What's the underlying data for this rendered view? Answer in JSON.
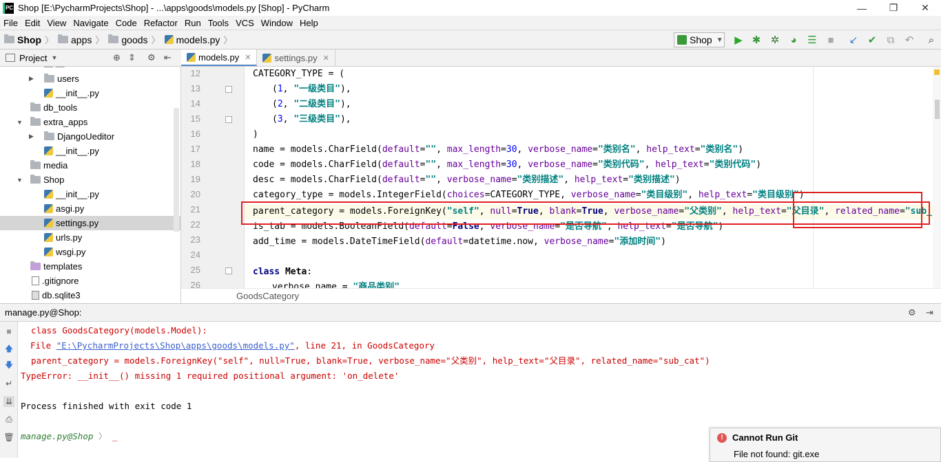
{
  "window": {
    "title": "Shop [E:\\PycharmProjects\\Shop] - ...\\apps\\goods\\models.py [Shop] - PyCharm",
    "icon_text": "PC"
  },
  "menu": [
    "File",
    "Edit",
    "View",
    "Navigate",
    "Code",
    "Refactor",
    "Run",
    "Tools",
    "VCS",
    "Window",
    "Help"
  ],
  "breadcrumb": [
    "Shop",
    "apps",
    "goods",
    "models.py"
  ],
  "run_config": "Shop",
  "project_panel": {
    "title": "Project"
  },
  "tree": [
    {
      "label": "users",
      "type": "folder",
      "expand": "collapsed"
    },
    {
      "label": "__init__.py",
      "type": "py"
    },
    {
      "label": "db_tools",
      "type": "folder"
    },
    {
      "label": "extra_apps",
      "type": "folder",
      "expand": "expanded"
    },
    {
      "label": "DjangoUeditor",
      "type": "folder",
      "expand": "collapsed"
    },
    {
      "label": "__init__.py",
      "type": "py"
    },
    {
      "label": "media",
      "type": "folder"
    },
    {
      "label": "Shop",
      "type": "folder",
      "expand": "expanded"
    },
    {
      "label": "__init__.py",
      "type": "py"
    },
    {
      "label": "asgi.py",
      "type": "py"
    },
    {
      "label": "settings.py",
      "type": "py",
      "selected": true
    },
    {
      "label": "urls.py",
      "type": "py"
    },
    {
      "label": "wsgi.py",
      "type": "py"
    },
    {
      "label": "templates",
      "type": "folder"
    },
    {
      "label": ".gitignore",
      "type": "file"
    },
    {
      "label": "db.sqlite3",
      "type": "file"
    }
  ],
  "tabs": [
    {
      "label": "models.py",
      "active": true
    },
    {
      "label": "settings.py",
      "active": false
    }
  ],
  "line_numbers": [
    "12",
    "13",
    "14",
    "15",
    "16",
    "17",
    "18",
    "19",
    "20",
    "21",
    "22",
    "23",
    "24",
    "25",
    "26"
  ],
  "code": {
    "l12": "CATEGORY_TYPE = (",
    "l13_num": "1",
    "l13_str": "\"一级类目\"",
    "l14_num": "2",
    "l14_str": "\"二级类目\"",
    "l15_num": "3",
    "l15_str": "\"三级类目\"",
    "l16": ")",
    "l17": {
      "a": "name = models.CharField(",
      "s1": "\"\"",
      "n": "30",
      "s2": "\"类别名\"",
      "s3": "\"类别名\""
    },
    "l18": {
      "a": "code = models.CharField(",
      "s1": "\"\"",
      "n": "30",
      "s2": "\"类别代码\"",
      "s3": "\"类别代码\""
    },
    "l19": {
      "a": "desc = models.CharField(",
      "s1": "\"\"",
      "s2": "\"类别描述\"",
      "s3": "\"类别描述\""
    },
    "l20": {
      "a": "category_type = models.IntegerField(",
      "b": "CATEGORY_TYPE",
      "s2": "\"类目级别\"",
      "s3": "\"类目级别\""
    },
    "l21": {
      "a": "parent_category = models.ForeignKey(",
      "s0": "\"self\"",
      "s2": "\"父类别\"",
      "s3": "\"父目录\"",
      "s4": "\"sub_cat\""
    },
    "l22": {
      "a": "is_tab = models.BooleanField(",
      "s2": "\"是否导航\"",
      "s3": "\"是否导航\""
    },
    "l23": {
      "a": "add_time = models.DateTimeField(",
      "b": "datetime.now",
      "s2": "\"添加时间\""
    },
    "l25_kw": "class",
    "l25_name": "Meta",
    "l26": "verbose_name = ",
    "l26_str": "\"商品类别\""
  },
  "editor_footer": "GoodsCategory",
  "run_panel": {
    "title": "manage.py@Shop:"
  },
  "console": {
    "line1": "  class GoodsCategory(models.Model):",
    "line2_a": "File ",
    "line2_link": "\"E:\\PycharmProjects\\Shop\\apps\\goods\\models.py\"",
    "line2_b": ", line 21, in GoodsCategory",
    "line3": "  parent_category = models.ForeignKey(\"self\", null=True, blank=True, verbose_name=\"父类别\", help_text=\"父目录\", related_name=\"sub_cat\")",
    "line4": "TypeError: __init__() missing 1 required positional argument: 'on_delete'",
    "line5": "Process finished with exit code 1",
    "prompt": "manage.py@Shop"
  },
  "notification": {
    "title": "Cannot Run Git",
    "body": "File not found: git.exe"
  },
  "colors": {
    "highlight_box": "#e02020",
    "accent": "#4e85c6"
  }
}
